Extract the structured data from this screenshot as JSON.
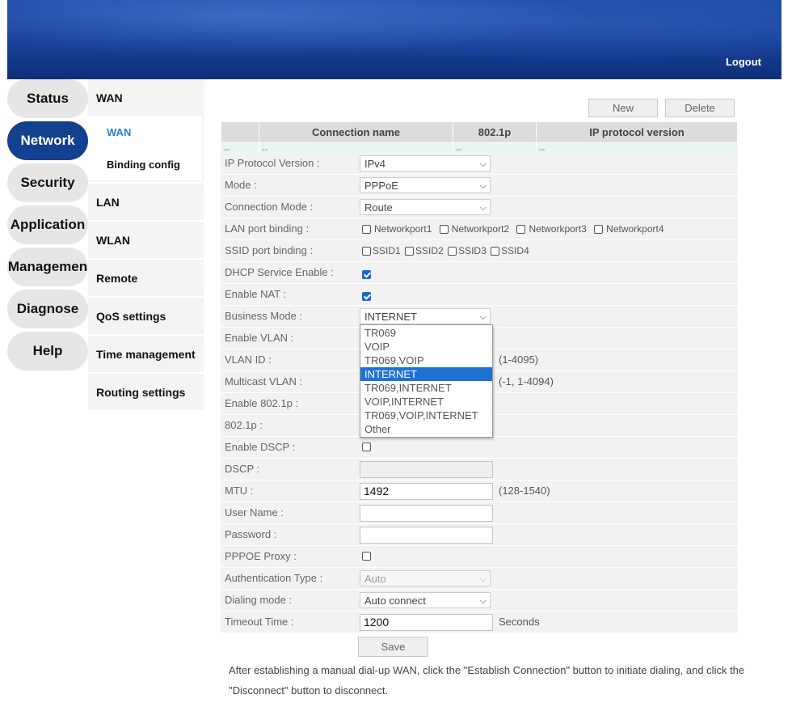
{
  "header": {
    "logout_label": "Logout"
  },
  "main_nav": [
    {
      "label": "Status",
      "active": false
    },
    {
      "label": "Network",
      "active": true
    },
    {
      "label": "Security",
      "active": false
    },
    {
      "label": "Application",
      "active": false
    },
    {
      "label": "Managemen",
      "active": false
    },
    {
      "label": "Diagnose",
      "active": false
    },
    {
      "label": "Help",
      "active": false
    }
  ],
  "sub_nav": {
    "wan": "WAN",
    "wan_children": [
      "WAN",
      "Binding config"
    ],
    "items": [
      "LAN",
      "WLAN",
      "Remote",
      "QoS settings",
      "Time management",
      "Routing settings"
    ]
  },
  "toolbar": {
    "new_label": "New",
    "delete_label": "Delete"
  },
  "conn_table": {
    "headers": [
      "",
      "Connection name",
      "802.1p",
      "IP protocol version"
    ],
    "row": [
      "--",
      "--",
      "--",
      "--"
    ]
  },
  "form": {
    "ip_protocol_version": {
      "label": "IP Protocol Version :",
      "value": "IPv4"
    },
    "mode": {
      "label": "Mode :",
      "value": "PPPoE"
    },
    "connection_mode": {
      "label": "Connection Mode :",
      "value": "Route"
    },
    "lan_port_binding": {
      "label": "LAN port binding :",
      "options": [
        "Networkport1",
        "Networkport2",
        "Networkport3",
        "Networkport4"
      ]
    },
    "ssid_port_binding": {
      "label": "SSID port binding :",
      "options": [
        "SSID1",
        "SSID2",
        "SSID3",
        "SSID4"
      ]
    },
    "dhcp_service_enable": {
      "label": "DHCP Service Enable :",
      "checked": true
    },
    "enable_nat": {
      "label": "Enable NAT :",
      "checked": true
    },
    "business_mode": {
      "label": "Business Mode :",
      "value": "INTERNET"
    },
    "enable_vlan": {
      "label": "Enable VLAN :"
    },
    "vlan_id": {
      "label": "VLAN ID :",
      "hint": "(1-4095)"
    },
    "multicast_vlan": {
      "label": "Multicast VLAN :",
      "hint": "(-1, 1-4094)"
    },
    "enable_8021p": {
      "label": "Enable 802.1p :"
    },
    "p8021": {
      "label": "802.1p :"
    },
    "enable_dscp": {
      "label": "Enable DSCP :",
      "checked": false
    },
    "dscp": {
      "label": "DSCP :",
      "value": ""
    },
    "mtu": {
      "label": "MTU :",
      "value": "1492",
      "hint": "(128-1540)"
    },
    "user_name": {
      "label": "User Name :",
      "value": ""
    },
    "password": {
      "label": "Password :",
      "value": ""
    },
    "pppoe_proxy": {
      "label": "PPPOE Proxy :",
      "checked": false
    },
    "authentication_type": {
      "label": "Authentication Type :",
      "value": "Auto"
    },
    "dialing_mode": {
      "label": "Dialing mode :",
      "value": "Auto connect"
    },
    "timeout_time": {
      "label": "Timeout Time :",
      "value": "1200",
      "hint": "Seconds"
    }
  },
  "business_mode_dropdown": {
    "options": [
      "TR069",
      "VOIP",
      "TR069,VOIP",
      "INTERNET",
      "TR069,INTERNET",
      "VOIP,INTERNET",
      "TR069,VOIP,INTERNET",
      "Other"
    ],
    "selected": "INTERNET"
  },
  "save_label": "Save",
  "note": "After establishing a manual dial-up WAN, click the \"Establish Connection\" button to initiate dialing, and click the \"Disconnect\" button to disconnect.",
  "colors": {
    "nav_active": "#13408f",
    "link_active": "#2a7fd4",
    "dropdown_selected": "#1e72d6",
    "checkbox": "#1a67d2"
  },
  "icons": {
    "select_arrow": "chevron-down-icon",
    "checkbox_checked": "checkmark-icon"
  }
}
